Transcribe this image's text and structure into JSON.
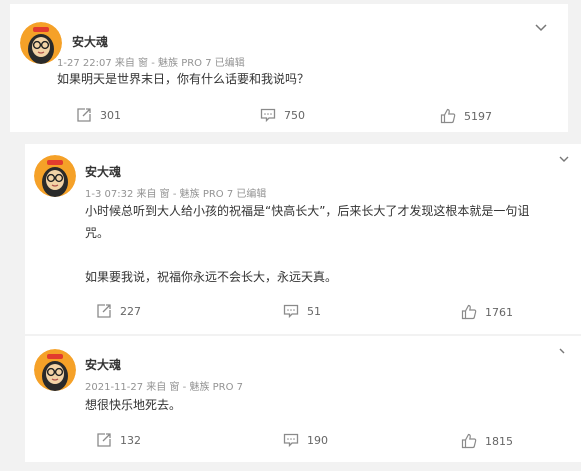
{
  "posts": [
    {
      "author": "安大魂",
      "meta": "1-27 22:07 来自 窗 - 魅族 PRO 7 已编辑",
      "lines": [
        "如果明天是世界末日，你有什么话要和我说吗？"
      ],
      "reposts": "301",
      "comments": "750",
      "likes": "5197"
    },
    {
      "author": "安大魂",
      "meta": "1-3 07:32 来自 窗 - 魅族 PRO 7 已编辑",
      "lines": [
        "小时候总听到大人给小孩的祝福是“快高长大”，后来长大了才发现这根本就是一句诅",
        "咒。",
        "",
        "如果要我说，祝福你永远不会长大，永远天真。"
      ],
      "reposts": "227",
      "comments": "51",
      "likes": "1761"
    },
    {
      "author": "安大魂",
      "meta": "2021-11-27 来自 窗 - 魅族 PRO 7",
      "lines": [
        "想很快乐地死去。"
      ],
      "reposts": "132",
      "comments": "190",
      "likes": "1815"
    }
  ],
  "icons": {
    "repost": "repost-icon",
    "comment": "comment-icon",
    "like": "thumbs-up-icon",
    "menu": "chevron-down-icon"
  },
  "colors": {
    "avatar_bg": "#f5a128",
    "icon": "#8a8a8a",
    "meta_text": "#939393"
  }
}
